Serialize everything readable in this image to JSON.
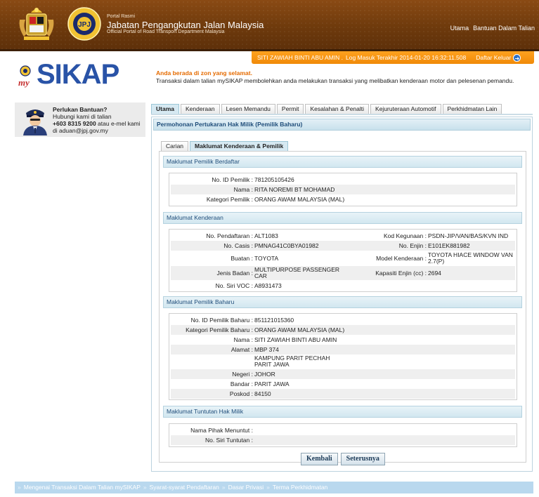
{
  "header": {
    "portal_small": "Portal Rasmi",
    "portal_title": "Jabatan Pengangkutan Jalan Malaysia",
    "portal_sub": "Official Portal of Road Transport Department Malaysia",
    "nav": [
      "Utama",
      "Bantuan Dalam Talian"
    ]
  },
  "loginbar": {
    "user": "SITI ZAWIAH BINTI ABU AMIN .",
    "last_login": "Log Masuk Terakhir 2014-01-20 16:32:11.508",
    "logout": "Daftar Keluar",
    "logout_icon": "arrow-right-circle-icon"
  },
  "logo": {
    "my": "my",
    "sikap": "SIKAP"
  },
  "notice": {
    "zone": "Anda berada di zon yang selamat.",
    "desc": "Transaksi dalam talian mySIKAP membolehkan anda melakukan transaksi yang melibatkan kenderaan motor dan pelesenan pemandu."
  },
  "help": {
    "title": "Perlukan Bantuan?",
    "line1": "Hubungi kami di talian",
    "phone": "+603 8315 9200",
    "line2": " atau e-mel kami",
    "email": "di aduan@jpj.gov.my"
  },
  "tabs": [
    "Utama",
    "Kenderaan",
    "Lesen Memandu",
    "Permit",
    "Kesalahan & Penalti",
    "Kejuruteraan Automotif",
    "Perkhidmatan Lain"
  ],
  "panel": {
    "title": "Permohonan Pertukaran Hak Milik (Pemilik Baharu)",
    "subtabs": [
      "Carian",
      "Maklumat Kenderaan & Pemilik"
    ]
  },
  "sections": {
    "pemilik_berdaftar": {
      "title": "Maklumat Pemilik Berdaftar",
      "rows": [
        {
          "label": "No. ID Pemilik :",
          "value": "781205105426"
        },
        {
          "label": "Nama :",
          "value": "RITA NOREMI BT MOHAMAD"
        },
        {
          "label": "Kategori Pemilik :",
          "value": "ORANG AWAM MALAYSIA (MAL)"
        }
      ]
    },
    "kenderaan": {
      "title": "Maklumat Kenderaan",
      "rows": [
        {
          "label": "No. Pendaftaran :",
          "value": "ALT1083",
          "label2": "Kod Kegunaan :",
          "value2": "PSDN-JIP/VAN/BAS/KVN IND"
        },
        {
          "label": "No. Casis :",
          "value": "PMNAG41C0BYA01982",
          "label2": "No. Enjin :",
          "value2": "E101EK881982"
        },
        {
          "label": "Buatan :",
          "value": "TOYOTA",
          "label2": "Model Kenderaan :",
          "value2": "TOYOTA HIACE WINDOW VAN 2.7(P)"
        },
        {
          "label": "Jenis Badan :",
          "value": "MULTIPURPOSE PASSENGER CAR",
          "label2": "Kapasiti Enjin (cc) :",
          "value2": "2694"
        },
        {
          "label": "No. Siri VOC :",
          "value": "A8931473",
          "label2": "",
          "value2": ""
        }
      ]
    },
    "pemilik_baharu": {
      "title": "Maklumat Pemilik Baharu",
      "rows": [
        {
          "label": "No. ID Pemilik Baharu :",
          "value": "851121015360"
        },
        {
          "label": "Kategori Pemilik Baharu :",
          "value": "ORANG AWAM MALAYSIA (MAL)"
        },
        {
          "label": "Nama :",
          "value": "SITI ZAWIAH BINTI ABU AMIN"
        },
        {
          "label": "Alamat :",
          "value": "MBP 374"
        },
        {
          "label": "",
          "value": "KAMPUNG PARIT PECHAH PARIT JAWA"
        },
        {
          "label": "Negeri :",
          "value": "JOHOR"
        },
        {
          "label": "Bandar :",
          "value": "PARIT JAWA"
        },
        {
          "label": "Poskod :",
          "value": "84150"
        }
      ]
    },
    "tuntutan": {
      "title": "Maklumat Tuntutan Hak Milik",
      "rows": [
        {
          "label": "Nama Pihak Menuntut :",
          "value": ""
        },
        {
          "label": "No. Siri Tuntutan :",
          "value": ""
        }
      ]
    }
  },
  "buttons": {
    "back": "Kembali",
    "next": "Seterusnya"
  },
  "footer": [
    "Mengenai Transaksi Dalam Talian mySIKAP",
    "Syarat-syarat Pendaftaran",
    "Dasar Privasi",
    "Terma Perkhidmatan"
  ],
  "colors": {
    "header_brown": "#6e3a0c",
    "login_orange": "#f08a08",
    "brand_blue": "#2953a7",
    "section_blue": "#d2e7f0"
  }
}
